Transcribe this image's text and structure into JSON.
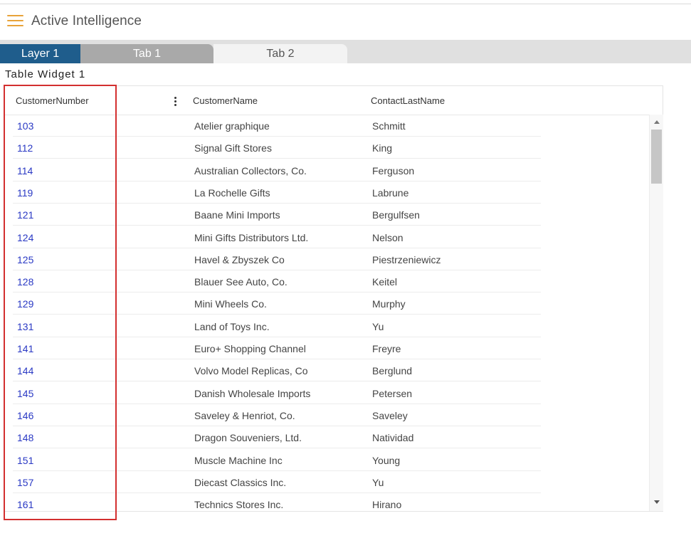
{
  "header": {
    "title": "Active Intelligence",
    "menu_icon": "hamburger-menu-icon",
    "accent_color": "#e8a33a"
  },
  "tabs": [
    {
      "label": "Layer 1",
      "active": true,
      "color": "#1f5d8c"
    },
    {
      "label": "Tab 1",
      "active": false,
      "color": "#a9a9a9"
    },
    {
      "label": "Tab 2",
      "active": false,
      "color": "#f3f3f3"
    }
  ],
  "widget": {
    "title": "Table Widget 1",
    "columns": [
      "CustomerNumber",
      "CustomerName",
      "ContactLastName"
    ],
    "column_menu_icon": "kebab-menu-icon",
    "link_color": "#2a39c4",
    "highlight_color": "#d32f2f",
    "rows": [
      [
        "103",
        "Atelier graphique",
        "Schmitt"
      ],
      [
        "112",
        "Signal Gift Stores",
        "King"
      ],
      [
        "114",
        "Australian Collectors, Co.",
        "Ferguson"
      ],
      [
        "119",
        "La Rochelle Gifts",
        "Labrune"
      ],
      [
        "121",
        "Baane Mini Imports",
        "Bergulfsen"
      ],
      [
        "124",
        "Mini Gifts Distributors Ltd.",
        "Nelson"
      ],
      [
        "125",
        "Havel & Zbyszek Co",
        "Piestrzeniewicz"
      ],
      [
        "128",
        "Blauer See Auto, Co.",
        "Keitel"
      ],
      [
        "129",
        "Mini Wheels Co.",
        "Murphy"
      ],
      [
        "131",
        "Land of Toys Inc.",
        "Yu"
      ],
      [
        "141",
        "Euro+ Shopping Channel",
        "Freyre"
      ],
      [
        "144",
        "Volvo Model Replicas, Co",
        "Berglund"
      ],
      [
        "145",
        "Danish Wholesale Imports",
        "Petersen"
      ],
      [
        "146",
        "Saveley & Henriot, Co.",
        "Saveley"
      ],
      [
        "148",
        "Dragon Souveniers, Ltd.",
        "Natividad"
      ],
      [
        "151",
        "Muscle Machine Inc",
        "Young"
      ],
      [
        "157",
        "Diecast Classics Inc.",
        "Yu"
      ],
      [
        "161",
        "Technics Stores Inc.",
        "Hirano"
      ]
    ]
  }
}
